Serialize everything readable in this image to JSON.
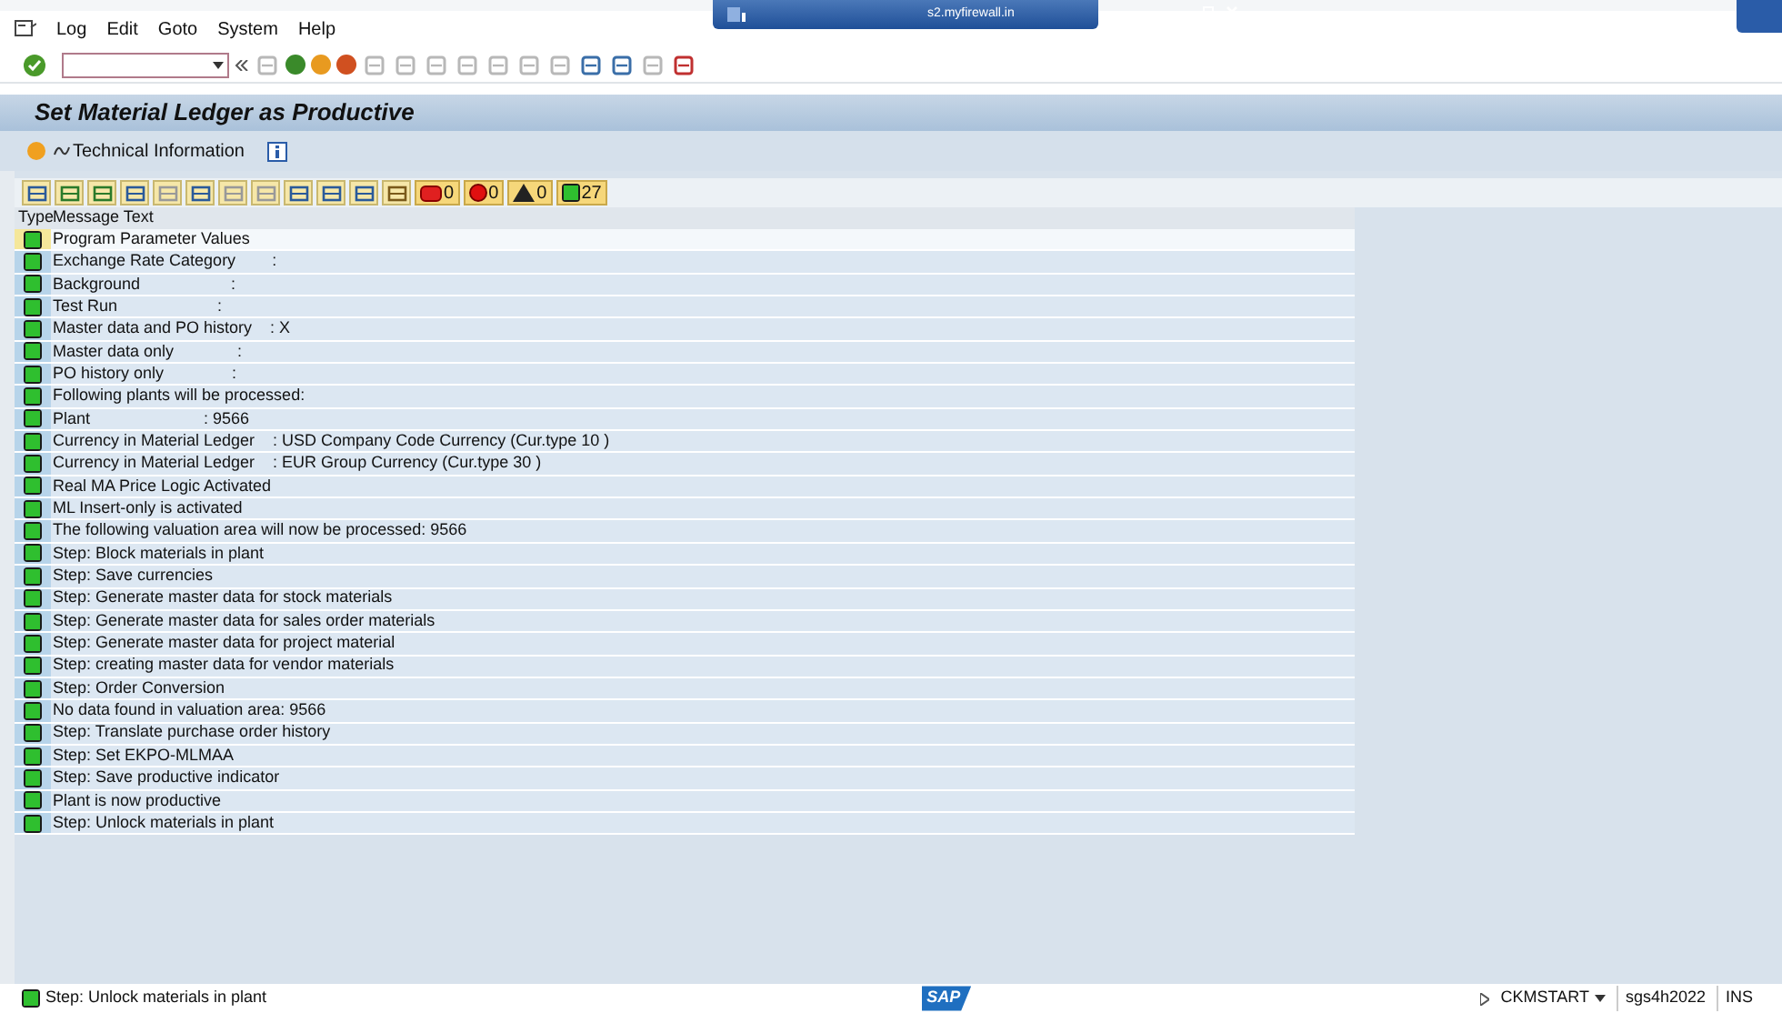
{
  "window": {
    "title": "s2.myfirewall.in"
  },
  "menu": [
    "Log",
    "Edit",
    "Goto",
    "System",
    "Help"
  ],
  "screen_title": "Set Material Ledger as Productive",
  "app_toolbar": {
    "button": "Technical Information"
  },
  "counters": [
    {
      "kind": "stop",
      "count": "0"
    },
    {
      "kind": "error",
      "count": "0"
    },
    {
      "kind": "warning",
      "count": "0"
    },
    {
      "kind": "success",
      "count": "27"
    }
  ],
  "table": {
    "columns": [
      "Type",
      "Message Text"
    ],
    "rows": [
      {
        "kind": "success",
        "selected": true,
        "text": "Program Parameter Values"
      },
      {
        "kind": "success",
        "selected": false,
        "text": "Exchange Rate Category        :"
      },
      {
        "kind": "success",
        "selected": false,
        "text": "Background                    :"
      },
      {
        "kind": "success",
        "selected": false,
        "text": "Test Run                      :"
      },
      {
        "kind": "success",
        "selected": false,
        "text": "Master data and PO history    : X"
      },
      {
        "kind": "success",
        "selected": false,
        "text": "Master data only              :"
      },
      {
        "kind": "success",
        "selected": false,
        "text": "PO history only               :"
      },
      {
        "kind": "success",
        "selected": false,
        "text": "Following plants will be processed:"
      },
      {
        "kind": "success",
        "selected": false,
        "text": "Plant                         : 9566"
      },
      {
        "kind": "success",
        "selected": false,
        "text": "Currency in Material Ledger    : USD Company Code Currency (Cur.type 10 )"
      },
      {
        "kind": "success",
        "selected": false,
        "text": "Currency in Material Ledger    : EUR Group Currency (Cur.type 30 )"
      },
      {
        "kind": "success",
        "selected": false,
        "text": "Real MA Price Logic Activated"
      },
      {
        "kind": "success",
        "selected": false,
        "text": "ML Insert-only is activated"
      },
      {
        "kind": "success",
        "selected": false,
        "text": "The following valuation area will now be processed: 9566"
      },
      {
        "kind": "success",
        "selected": false,
        "text": "Step: Block materials in plant"
      },
      {
        "kind": "success",
        "selected": false,
        "text": "Step: Save currencies"
      },
      {
        "kind": "success",
        "selected": false,
        "text": "Step: Generate master data for stock materials"
      },
      {
        "kind": "success",
        "selected": false,
        "text": "Step: Generate master data for sales order materials"
      },
      {
        "kind": "success",
        "selected": false,
        "text": "Step: Generate master data for project material"
      },
      {
        "kind": "success",
        "selected": false,
        "text": "Step: creating master data for vendor materials"
      },
      {
        "kind": "success",
        "selected": false,
        "text": "Step: Order Conversion"
      },
      {
        "kind": "success",
        "selected": false,
        "text": "No data found in valuation area: 9566"
      },
      {
        "kind": "success",
        "selected": false,
        "text": "Step: Translate purchase order history"
      },
      {
        "kind": "success",
        "selected": false,
        "text": "Step: Set EKPO-MLMAA"
      },
      {
        "kind": "success",
        "selected": false,
        "text": "Step: Save productive indicator"
      },
      {
        "kind": "success",
        "selected": false,
        "text": "Plant is now productive"
      },
      {
        "kind": "success",
        "selected": false,
        "text": "Step: Unlock materials in plant"
      }
    ]
  },
  "status_bar": {
    "message": "Step: Unlock materials in plant",
    "kind": "success",
    "logo": "SAP",
    "transaction": "CKMSTART",
    "system": "sgs4h2022",
    "mode": "INS"
  }
}
